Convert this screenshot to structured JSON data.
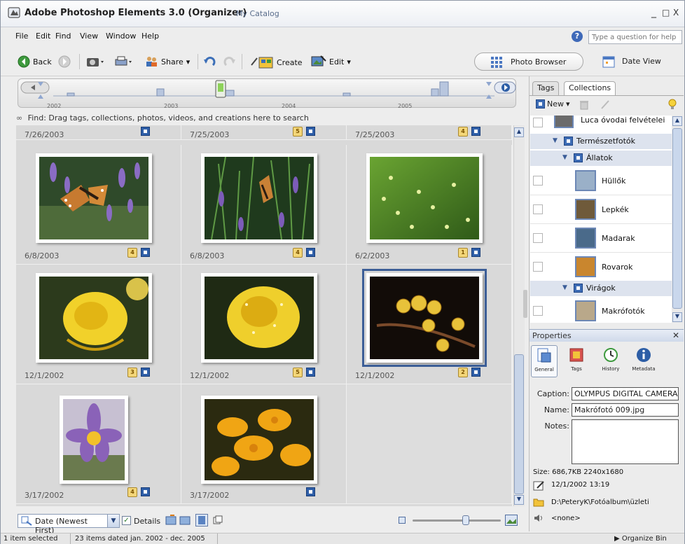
{
  "window": {
    "title": "Adobe Photoshop Elements 3.0 (Organizer)",
    "catalog": "My Catalog",
    "controls": [
      "_",
      "□",
      "X"
    ]
  },
  "menu": [
    "File",
    "Edit",
    "Find",
    "View",
    "Window",
    "Help"
  ],
  "help": {
    "placeholder": "Type a question for help"
  },
  "toolbar": {
    "back": "Back",
    "share": "Share",
    "create": "Create",
    "edit": "Edit",
    "photo_browser": "Photo Browser",
    "date_view": "Date View"
  },
  "timeline": {
    "years": [
      "2002",
      "2003",
      "2004",
      "2005"
    ]
  },
  "find_bar": "Find: Drag tags, collections, photos, videos, and creations here to search",
  "grid": {
    "top_row_dates": [
      "7/26/2003",
      "7/25/2003",
      "7/25/2003"
    ],
    "top_row_stars": [
      "",
      "5",
      "4"
    ],
    "photos": [
      {
        "date": "6/8/2003",
        "stars": "4",
        "subject": "butterfly-lavender"
      },
      {
        "date": "6/8/2003",
        "stars": "4",
        "subject": "butterfly-grass"
      },
      {
        "date": "6/2/2003",
        "stars": "1",
        "subject": "green-grass"
      },
      {
        "date": "12/1/2002",
        "stars": "3",
        "subject": "yellow-rose"
      },
      {
        "date": "12/1/2002",
        "stars": "5",
        "subject": "yellow-rose-drops"
      },
      {
        "date": "12/1/2002",
        "stars": "2",
        "subject": "berries",
        "selected": true
      },
      {
        "date": "3/17/2002",
        "stars": "4",
        "subject": "purple-crocus"
      },
      {
        "date": "3/17/2002",
        "stars": "",
        "subject": "yellow-crocus"
      }
    ]
  },
  "bottom": {
    "sort": "Date (Newest First)",
    "details": "Details"
  },
  "status": {
    "selected": "1 item selected",
    "range": "23 items dated jan. 2002 - dec. 2005",
    "organize_bin": "Organize Bin"
  },
  "panel": {
    "tabs": [
      "Tags",
      "Collections"
    ],
    "new_label": "New",
    "tree": [
      {
        "label": "Luca óvodai felvételei",
        "kind": "collection"
      },
      {
        "label": "Természetfotók",
        "kind": "group"
      },
      {
        "label": "Állatok",
        "kind": "group"
      },
      {
        "label": "Hüllők",
        "kind": "collection"
      },
      {
        "label": "Lepkék",
        "kind": "collection"
      },
      {
        "label": "Madarak",
        "kind": "collection"
      },
      {
        "label": "Rovarok",
        "kind": "collection"
      },
      {
        "label": "Virágok",
        "kind": "group"
      },
      {
        "label": "Makrófotók",
        "kind": "collection"
      }
    ]
  },
  "properties": {
    "title": "Properties",
    "tabs": [
      "General",
      "Tags",
      "History",
      "Metadata"
    ],
    "caption_label": "Caption:",
    "caption": "OLYMPUS DIGITAL CAMERA",
    "name_label": "Name:",
    "name": "Makrófotó 009.jpg",
    "notes_label": "Notes:",
    "size": "Size: 686,7KB  2240x1680",
    "datetime": "12/1/2002 13:19",
    "path": "D:\\PeteryK\\Fotóalbum\\üzleti",
    "audio": "<none>"
  }
}
